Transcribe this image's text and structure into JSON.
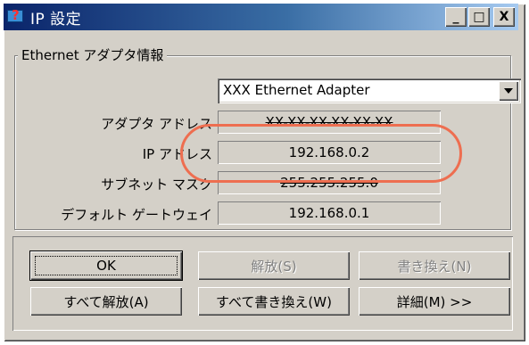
{
  "window": {
    "title": "IP 設定"
  },
  "titlebar_buttons": {
    "minimize": "_",
    "maximize": "□",
    "close": "X"
  },
  "group": {
    "label": "Ethernet  アダプタ情報",
    "adapter": "XXX Ethernet Adapter"
  },
  "rows": [
    {
      "label": "アダプタ アドレス",
      "value": "XX-XX-XX-XX-XX-XX"
    },
    {
      "label": "IP アドレス",
      "value": "192.168.0.2"
    },
    {
      "label": "サブネット マスク",
      "value": "255.255.255.0"
    },
    {
      "label": "デフォルト ゲートウェイ",
      "value": "192.168.0.1"
    }
  ],
  "buttons": {
    "ok": "OK",
    "release": "解放(S)",
    "renew": "書き換え(N)",
    "release_all": "すべて解放(A)",
    "renew_all": "すべて書き換え(W)",
    "details": "詳細(M) >>"
  },
  "colors": {
    "highlight": "#ee6e50",
    "titlebar": "#0a246a",
    "face": "#d4d0c8"
  }
}
